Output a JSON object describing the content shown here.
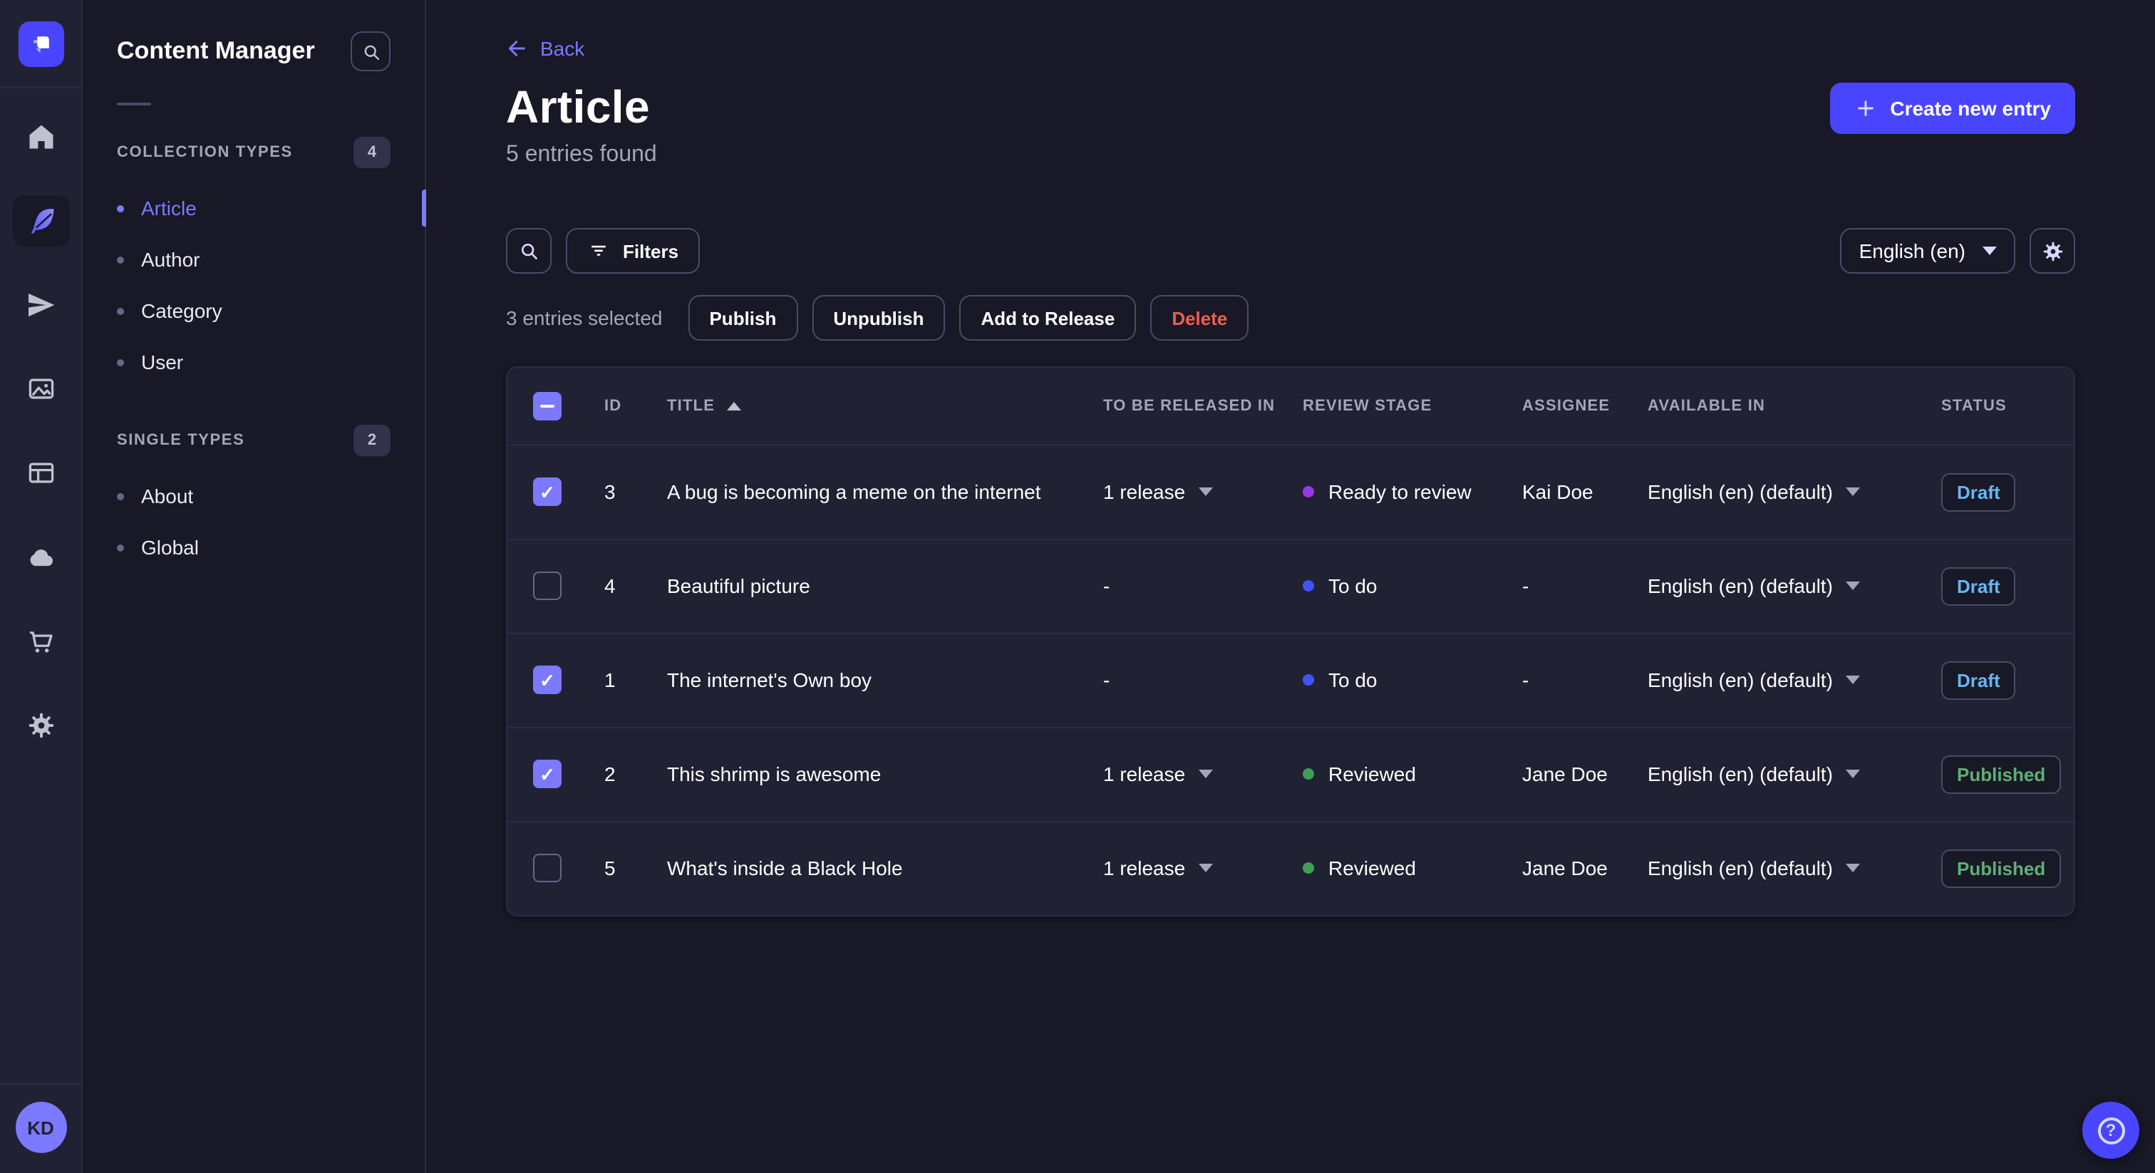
{
  "colors": {
    "primary": "#4945ff",
    "link_purple": "#7b79ff",
    "draft_text": "#66b7f1",
    "published_text": "#5cb176",
    "danger": "#ee5e52",
    "stage_todo": "#4152ff",
    "stage_ready_to_review": "#9736e8",
    "stage_reviewed": "#3f9e58"
  },
  "nav_rail": {
    "logo_icon": "strapi-logo",
    "icons": [
      "home-icon",
      "content-manager-icon",
      "releases-icon",
      "media-library-icon",
      "content-type-builder-icon",
      "deploy-icon",
      "marketplace-icon",
      "settings-icon"
    ],
    "active_icon": "content-manager-icon",
    "avatar_initials": "KD"
  },
  "sidebar": {
    "title": "Content Manager",
    "search_icon": "search-icon",
    "sections": [
      {
        "label": "COLLECTION TYPES",
        "count": "4",
        "items": [
          {
            "label": "Article",
            "active": true
          },
          {
            "label": "Author",
            "active": false
          },
          {
            "label": "Category",
            "active": false
          },
          {
            "label": "User",
            "active": false
          }
        ]
      },
      {
        "label": "SINGLE TYPES",
        "count": "2",
        "items": [
          {
            "label": "About",
            "active": false
          },
          {
            "label": "Global",
            "active": false
          }
        ]
      }
    ]
  },
  "header": {
    "back_label": "Back",
    "title": "Article",
    "subtitle": "5 entries found",
    "create_label": "Create new entry"
  },
  "toolbar": {
    "filters_label": "Filters",
    "locale_value": "English (en)"
  },
  "selection": {
    "summary": "3 entries selected",
    "actions": [
      "Publish",
      "Unpublish",
      "Add to Release",
      "Delete"
    ]
  },
  "table": {
    "select_all_state": "indeterminate",
    "columns": [
      "ID",
      "TITLE",
      "TO BE RELEASED IN",
      "REVIEW STAGE",
      "ASSIGNEE",
      "AVAILABLE IN",
      "STATUS"
    ],
    "sorted_by": "TITLE",
    "sort_direction": "asc",
    "rows": [
      {
        "checked": true,
        "id": "3",
        "title": "A bug is becoming a meme on the internet",
        "release": "1 release",
        "stage": "Ready to review",
        "stage_color": "#9736e8",
        "assignee": "Kai Doe",
        "available": "English (en) (default)",
        "status": "Draft"
      },
      {
        "checked": false,
        "id": "4",
        "title": "Beautiful picture",
        "release": "-",
        "stage": "To do",
        "stage_color": "#4152ff",
        "assignee": "-",
        "available": "English (en) (default)",
        "status": "Draft"
      },
      {
        "checked": true,
        "id": "1",
        "title": "The internet's Own boy",
        "release": "-",
        "stage": "To do",
        "stage_color": "#4152ff",
        "assignee": "-",
        "available": "English (en) (default)",
        "status": "Draft"
      },
      {
        "checked": true,
        "id": "2",
        "title": "This shrimp is awesome",
        "release": "1 release",
        "stage": "Reviewed",
        "stage_color": "#3f9e58",
        "assignee": "Jane Doe",
        "available": "English (en) (default)",
        "status": "Published"
      },
      {
        "checked": false,
        "id": "5",
        "title": "What's inside a Black Hole",
        "release": "1 release",
        "stage": "Reviewed",
        "stage_color": "#3f9e58",
        "assignee": "Jane Doe",
        "available": "English (en) (default)",
        "status": "Published"
      }
    ]
  },
  "help": {
    "icon": "help-icon"
  }
}
